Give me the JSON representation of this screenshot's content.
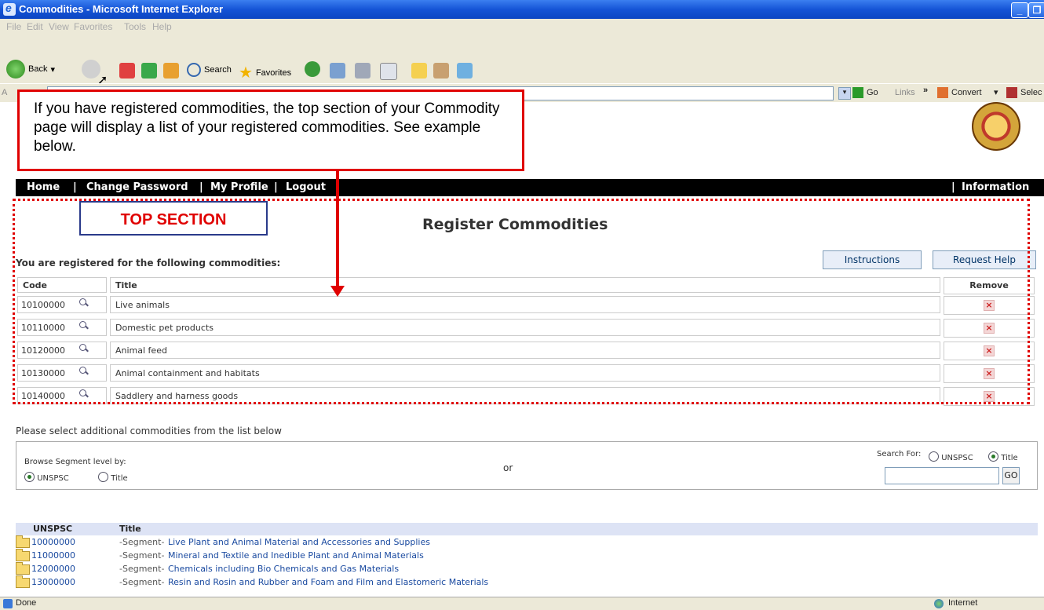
{
  "window": {
    "title": "Commodities - Microsoft Internet Explorer"
  },
  "menu": [
    "File",
    "Edit",
    "View",
    "Favorites",
    "Tools",
    "Help"
  ],
  "toolbar": {
    "back": "Back",
    "search": "Search",
    "favorites": "Favorites"
  },
  "address": {
    "label": "A",
    "go": "Go",
    "links": "Links",
    "convert": "Convert",
    "select": "Selec"
  },
  "nav": {
    "home": "Home",
    "change_password": "Change Password",
    "my_profile": "My Profile",
    "logout": "Logout",
    "information": "Information",
    "sep": "|"
  },
  "callout": {
    "text": "If you have registered commodities, the top section of your Commodity page will display a list of your registered commodities. See example below."
  },
  "top_section_label": "TOP SECTION",
  "register": {
    "title": "Register Commodities",
    "caption": "You are registered for the following commodities:",
    "instructions": "Instructions",
    "request_help": "Request Help",
    "headers": {
      "code": "Code",
      "title": "Title",
      "remove": "Remove"
    },
    "rows": [
      {
        "code": "10100000",
        "title": "Live animals"
      },
      {
        "code": "10110000",
        "title": "Domestic pet products"
      },
      {
        "code": "10120000",
        "title": "Animal feed"
      },
      {
        "code": "10130000",
        "title": "Animal containment and habitats"
      },
      {
        "code": "10140000",
        "title": "Saddlery and harness goods"
      }
    ]
  },
  "browse": {
    "caption": "Please select additional commodities from the list below",
    "browse_label": "Browse Segment level by:",
    "opt_unspsc": "UNSPSC",
    "opt_title": "Title",
    "or": "or",
    "search_for": "Search For:",
    "go": "GO"
  },
  "list": {
    "headers": {
      "unspsc": "UNSPSC",
      "title": "Title"
    },
    "rows": [
      {
        "code": "10000000",
        "prefix": "-Segment-",
        "title": "Live Plant and Animal Material and Accessories and Supplies"
      },
      {
        "code": "11000000",
        "prefix": "-Segment-",
        "title": "Mineral and Textile and Inedible Plant and Animal Materials"
      },
      {
        "code": "12000000",
        "prefix": "-Segment-",
        "title": "Chemicals including Bio Chemicals and Gas Materials"
      },
      {
        "code": "13000000",
        "prefix": "-Segment-",
        "title": "Resin and Rosin and Rubber and Foam and Film and Elastomeric Materials"
      }
    ]
  },
  "status": {
    "left": "Done",
    "zone": "Internet"
  }
}
